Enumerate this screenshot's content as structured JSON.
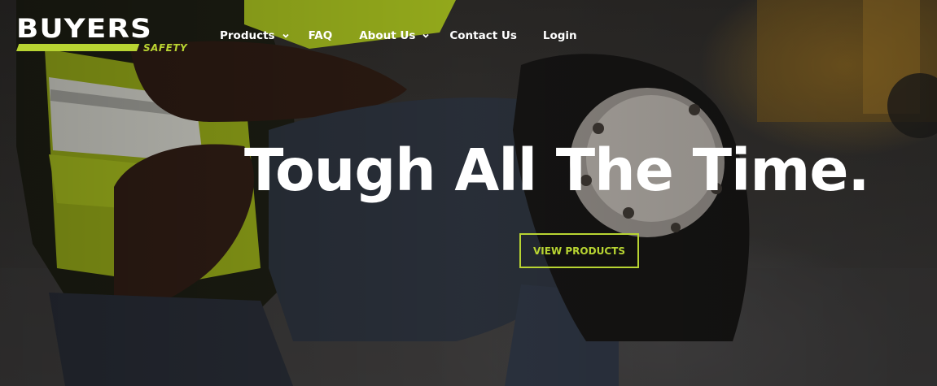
{
  "brand": {
    "name": "BUYERS",
    "tagline": "SAFETY",
    "accent_color": "#b8d432"
  },
  "nav": {
    "items": [
      {
        "label": "Products",
        "has_dropdown": true,
        "icon": "chevron-down-icon"
      },
      {
        "label": "FAQ",
        "has_dropdown": false
      },
      {
        "label": "About Us",
        "has_dropdown": true,
        "icon": "chevron-down-icon"
      },
      {
        "label": "Contact Us",
        "has_dropdown": false
      },
      {
        "label": "Login",
        "has_dropdown": false
      }
    ]
  },
  "hero": {
    "headline": "Tough All The Time.",
    "cta_label": "VIEW PRODUCTS"
  }
}
